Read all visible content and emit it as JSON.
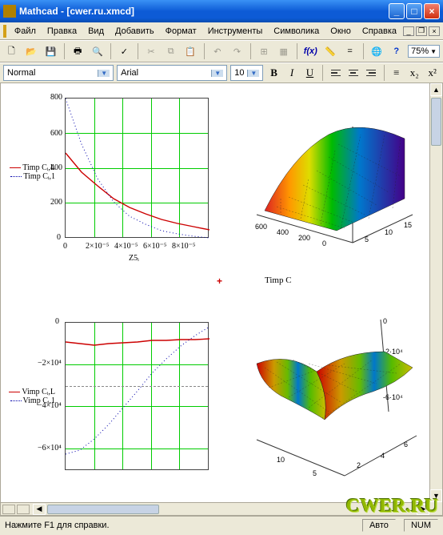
{
  "window": {
    "title": "Mathcad - [cwer.ru.xmcd]"
  },
  "menu": {
    "items": [
      "Файл",
      "Правка",
      "Вид",
      "Добавить",
      "Формат",
      "Инструменты",
      "Символика",
      "Окно",
      "Справка"
    ]
  },
  "toolbar": {
    "new": "new",
    "open": "open",
    "save": "save",
    "print": "print",
    "preview": "preview",
    "spell": "spell",
    "cut": "cut",
    "copy": "copy",
    "paste": "paste",
    "undo": "undo",
    "redo": "redo",
    "align": "align",
    "fx": "fx",
    "go": "go",
    "help": "help",
    "zoom": "75%"
  },
  "format": {
    "style": "Normal",
    "font": "Arial",
    "size": "10",
    "bold": "B",
    "italic": "I",
    "underline": "U"
  },
  "status": {
    "help": "Нажмите F1 для справки.",
    "auto": "Авто",
    "num": "NUM"
  },
  "watermark": "CWER.RU",
  "misc": {
    "middle_label": "Timp C",
    "xaxis_label_1": "Z5ᵢ"
  },
  "legend1": {
    "a": "Timp Cᵢ,L",
    "b": "Timp Cᵢ,1"
  },
  "legend2": {
    "a": "Vimp Cᵢ,L",
    "b": "Vimp Cᵢ,1"
  },
  "chart_data": [
    {
      "type": "line",
      "title": "",
      "xlabel": "Z5_i",
      "ylabel": "",
      "xlim": [
        0,
        9e-05
      ],
      "ylim": [
        0,
        800
      ],
      "xticks": [
        0,
        2e-05,
        4e-05,
        6e-05,
        8e-05
      ],
      "yticks": [
        0,
        200,
        400,
        600,
        800
      ],
      "x": [
        0,
        1e-05,
        2e-05,
        3e-05,
        4e-05,
        5e-05,
        6e-05,
        7e-05,
        8e-05,
        9e-05
      ],
      "series": [
        {
          "name": "Timp C_i,L",
          "color": "#c00",
          "values": [
            490,
            380,
            300,
            230,
            180,
            140,
            110,
            85,
            65,
            50
          ]
        },
        {
          "name": "Timp C_i,1",
          "color": "#00a",
          "style": "dotted",
          "values": [
            800,
            540,
            340,
            210,
            130,
            80,
            45,
            25,
            12,
            5
          ]
        }
      ]
    },
    {
      "type": "line",
      "title": "",
      "xlabel": "",
      "ylabel": "",
      "xlim": [
        0,
        1
      ],
      "ylim": [
        -70000.0,
        0
      ],
      "yticks": [
        0,
        -20000.0,
        -40000.0,
        -60000.0
      ],
      "x": [
        0,
        0.1,
        0.2,
        0.3,
        0.4,
        0.5,
        0.6,
        0.7,
        0.8,
        0.9,
        1.0
      ],
      "series": [
        {
          "name": "Vimp C_i,L",
          "color": "#c00",
          "values": [
            -9000.0,
            -10000.0,
            -10500.0,
            -10000.0,
            -9500.0,
            -9000.0,
            -8500.0,
            -8200.0,
            -8000.0,
            -7800.0,
            -7500.0
          ]
        },
        {
          "name": "Vimp C_i,1",
          "color": "#00a",
          "style": "dotted",
          "values": [
            -62000.0,
            -60000.0,
            -55000.0,
            -48000.0,
            -40000.0,
            -32000.0,
            -24000.0,
            -17000.0,
            -11000.0,
            -6000.0,
            -2000.0
          ]
        }
      ]
    },
    {
      "type": "surface",
      "title": "Timp C",
      "x_range": [
        0,
        15
      ],
      "y_range": [
        0,
        700
      ],
      "z_range": [
        0,
        7
      ],
      "xticks": [
        5,
        10,
        15
      ],
      "yticks": [
        200,
        400,
        600
      ],
      "description": "3D surface colored from red (low x) through green to blue/purple (high x), increasing then curving"
    },
    {
      "type": "surface",
      "title": "",
      "x_range": [
        0,
        6
      ],
      "y_range": [
        0,
        10
      ],
      "z_range": [
        -60000.0,
        0
      ],
      "xticks": [
        2,
        4,
        6
      ],
      "yticks": [
        5,
        10
      ],
      "zticks": [
        0,
        -20000.0,
        -60000.0
      ],
      "description": "3D saddle-like surface dipping to -6e4, colored blue/green in dip, yellow at edges"
    }
  ]
}
